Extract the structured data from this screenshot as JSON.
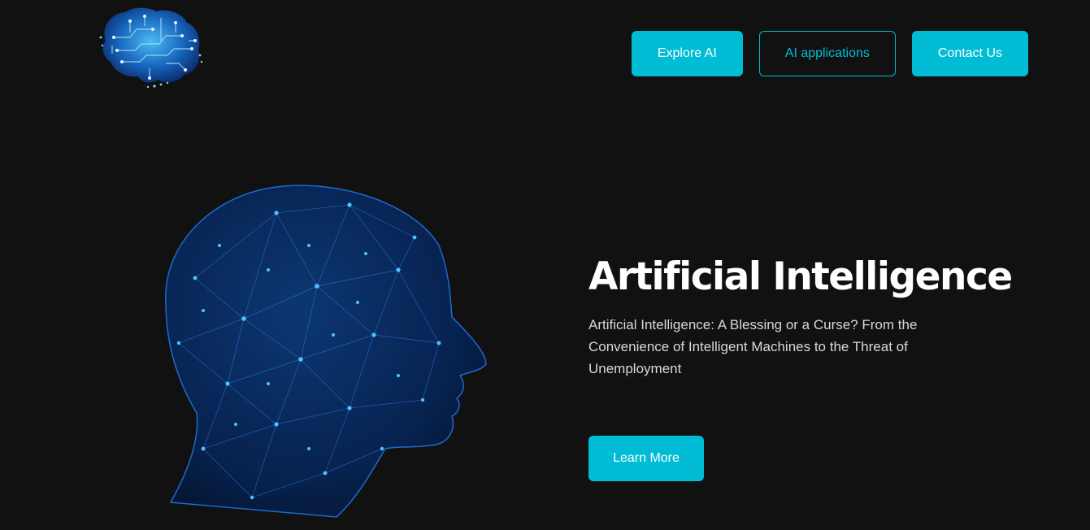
{
  "header": {
    "logo_icon": "circuit-brain-icon",
    "nav": {
      "explore_label": "Explore AI",
      "applications_label": "AI applications",
      "contact_label": "Contact Us"
    }
  },
  "hero": {
    "image_icon": "neural-network-head-icon",
    "title": "Artificial Intelligence",
    "description": "Artificial Intelligence: A Blessing or a Curse? From the Convenience of Intelligent Machines to the Threat of Unemployment",
    "cta_label": "Learn More"
  },
  "colors": {
    "background": "#111111",
    "accent": "#00bcd4",
    "title_text": "#ffffff",
    "body_text": "#d8d8d8",
    "network_blue": "#1e90ff"
  }
}
